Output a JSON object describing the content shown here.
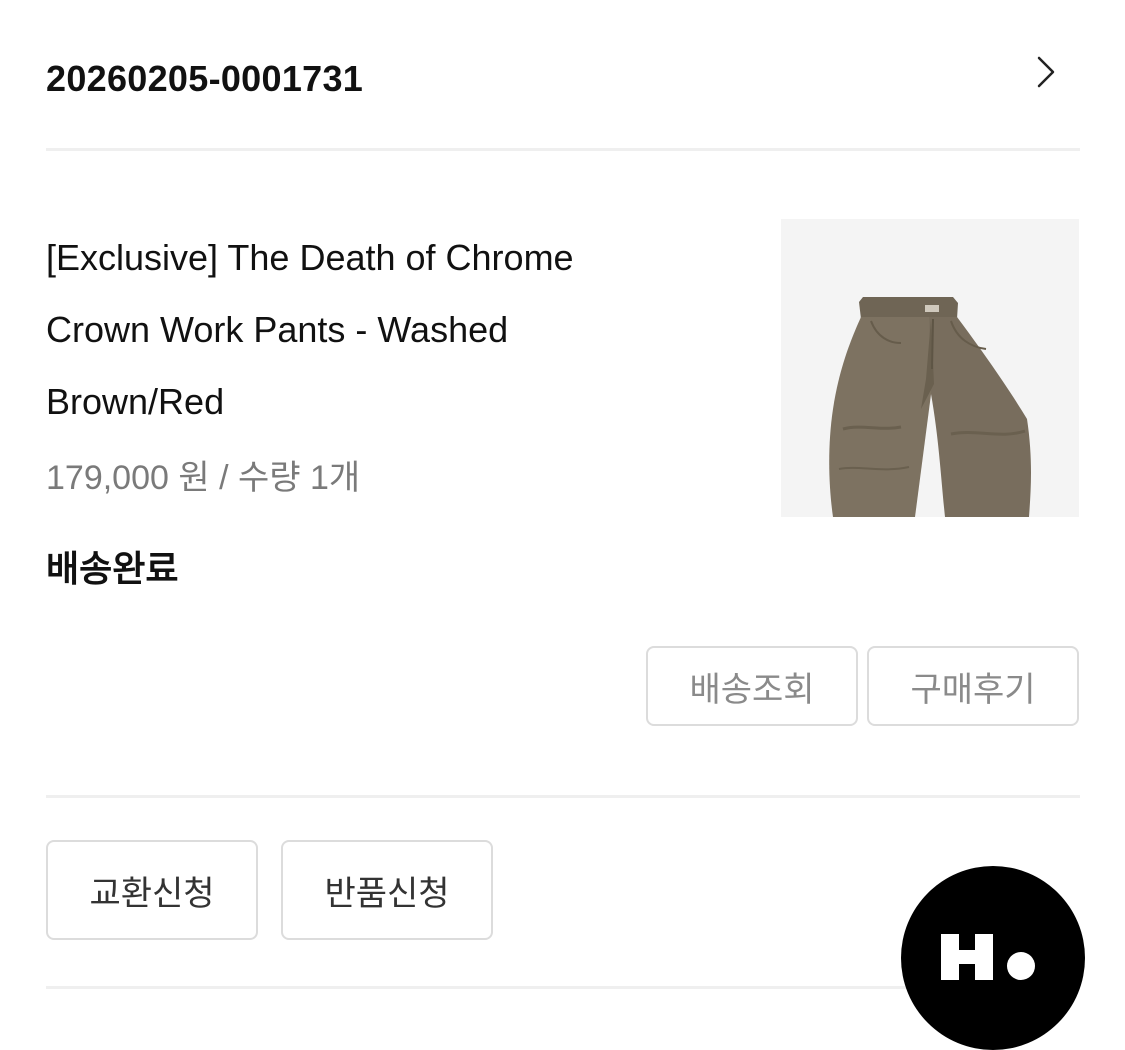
{
  "order": {
    "number": "20260205-0001731"
  },
  "product": {
    "name": "[Exclusive] The Death of Chrome Crown Work Pants - Washed Brown/Red",
    "price_line": "179,000 원 / 수량 1개",
    "status": "배송완료",
    "image_icon": "brown-work-pants-image"
  },
  "actions": {
    "track_label": "배송조회",
    "review_label": "구매후기",
    "exchange_label": "교환신청",
    "return_label": "반품신청"
  },
  "brand": {
    "logo_text": "H."
  },
  "colors": {
    "border": "#dcdcdc",
    "divider": "#efefef",
    "muted_text": "#7a7a7a",
    "pants_brown": "#7d7261"
  }
}
